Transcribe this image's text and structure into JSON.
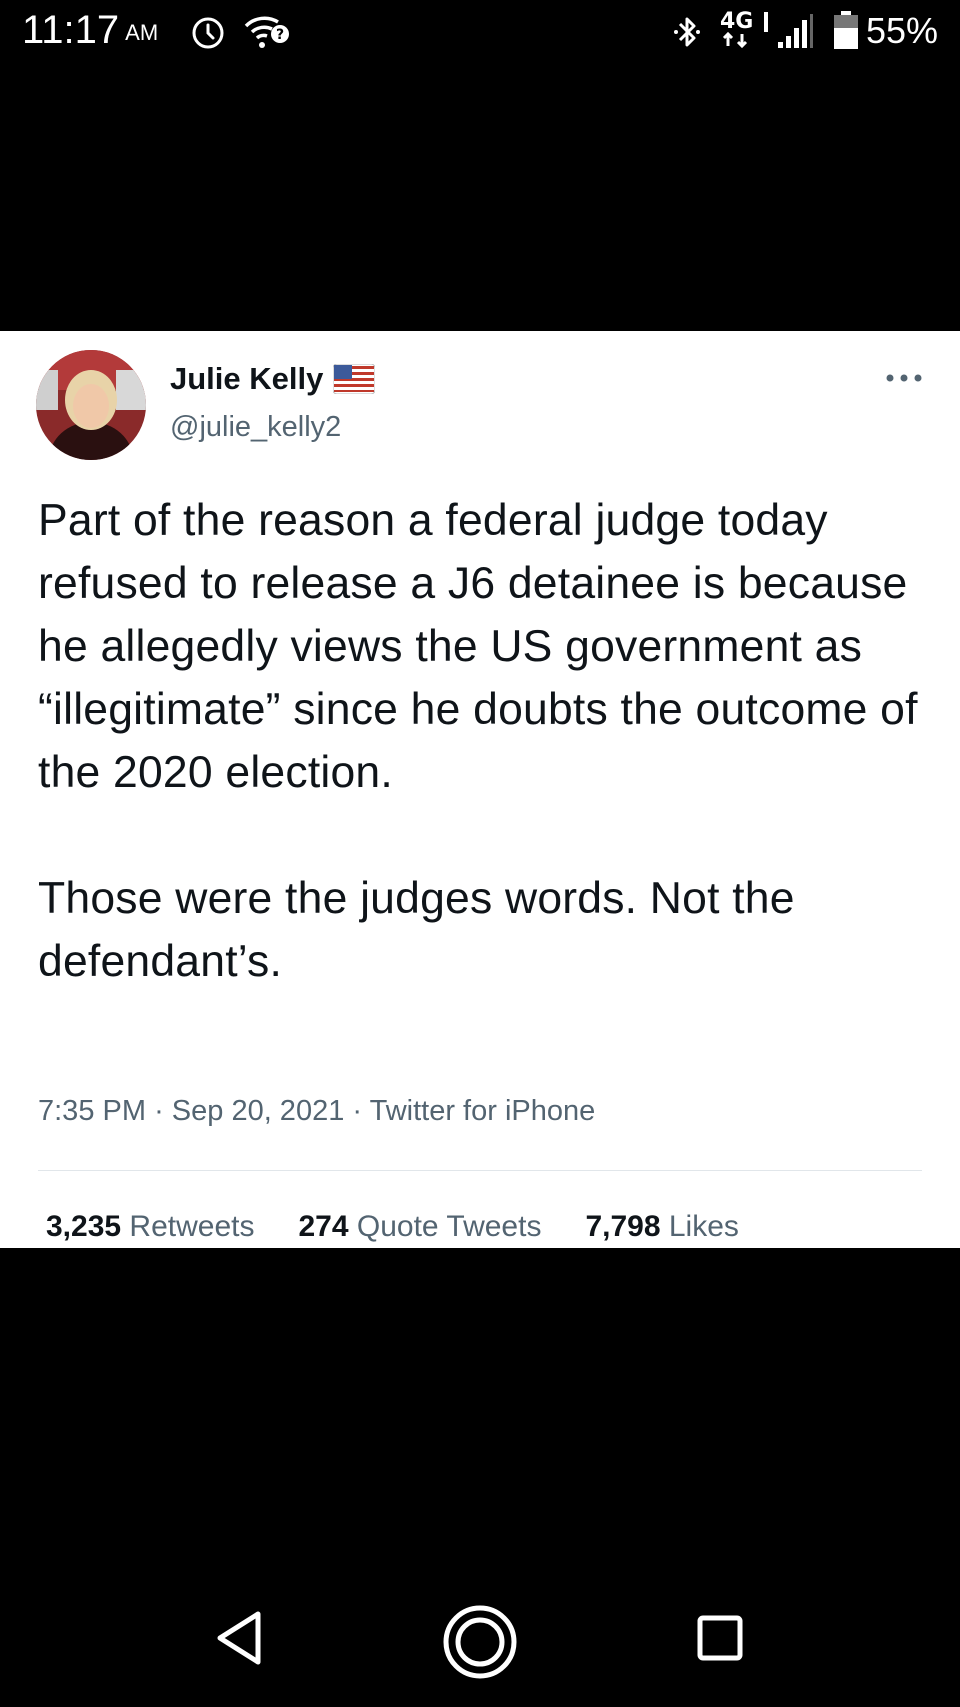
{
  "status_bar": {
    "time": "11:17",
    "ampm": "AM",
    "network": "4G",
    "battery": "55%",
    "icons": [
      "alarm-icon",
      "wifi-question-icon",
      "bluetooth-icon",
      "4g-lte-icon",
      "signal-icon",
      "battery-icon"
    ]
  },
  "tweet": {
    "display_name": "Julie Kelly",
    "handle": "@julie_kelly2",
    "text_paragraphs": [
      "Part of the reason a federal judge today refused to release a J6 detainee is because he allegedly views the US government as “illegitimate” since he doubts the outcome of the 2020 election.",
      "Those were the judges words. Not the defendant’s."
    ],
    "time": "7:35 PM",
    "date": "Sep 20, 2021",
    "source": "Twitter for iPhone",
    "stats": {
      "retweets_count": "3,235",
      "retweets_label": "Retweets",
      "quotes_count": "274",
      "quotes_label": "Quote Tweets",
      "likes_count": "7,798",
      "likes_label": "Likes"
    }
  },
  "colors": {
    "text_primary": "#0f1419",
    "text_secondary": "#536471",
    "background": "#000000",
    "card": "#ffffff"
  },
  "nav_bar": {
    "buttons": [
      "back-icon",
      "home-icon",
      "recents-icon"
    ]
  }
}
